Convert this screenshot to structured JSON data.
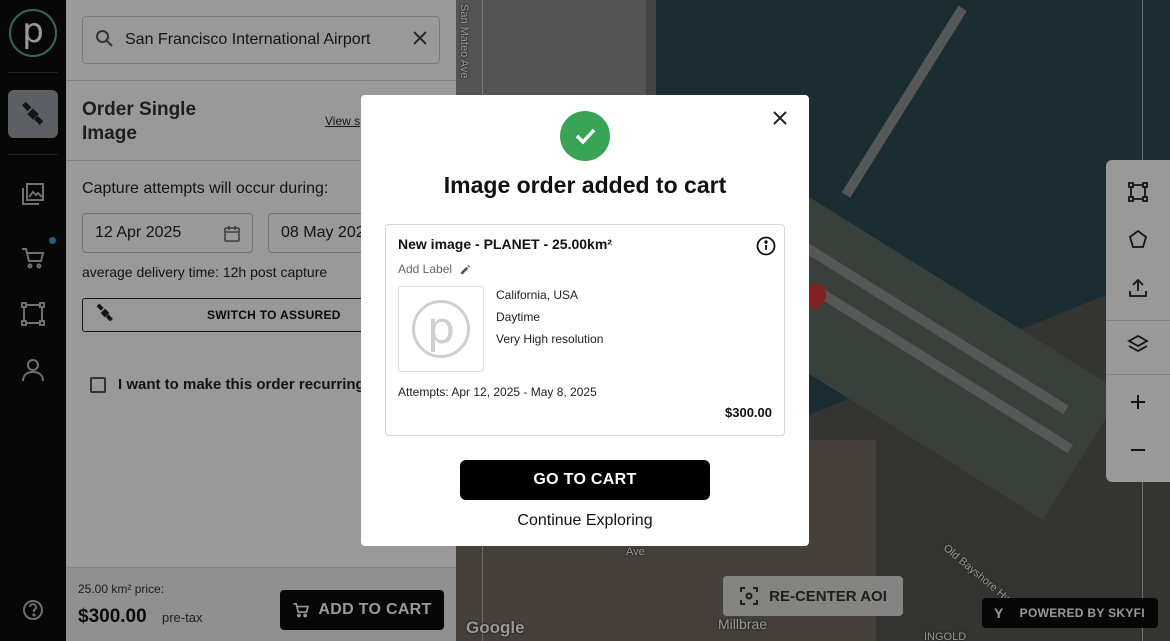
{
  "search": {
    "value": "San Francisco International Airport"
  },
  "panel": {
    "title": "Order Single Image",
    "view_link": "View s",
    "capture_label": "Capture attempts will occur during:",
    "start_date": "12 Apr 2025",
    "end_date": "08 May 202",
    "avg_delivery": "average delivery time: 12h post capture",
    "switch_label": "SWITCH TO ASSURED",
    "recurring_label": "I want to make this order recurring"
  },
  "footer": {
    "price_label": "25.00 km² price:",
    "price": "$300.00",
    "pretax": "pre-tax",
    "cart_button": "ADD TO CART"
  },
  "map": {
    "street_1": "San Mateo Ave",
    "street_2": "Old Bayshore Hwy",
    "street_3": "Ave",
    "place": "Millbrae",
    "place_2": "INGOLD",
    "attribution": "Google",
    "recenter": "RE-CENTER AOI",
    "powered": "POWERED BY SKYFI"
  },
  "modal": {
    "heading": "Image order added to cart",
    "card": {
      "title": "New image - PLANET - 25.00km²",
      "add_label": "Add Label",
      "location": "California, USA",
      "time": "Daytime",
      "resolution": "Very High resolution",
      "attempts": "Attempts: Apr 12, 2025 - May 8, 2025",
      "price": "$300.00"
    },
    "go_to_cart": "GO TO CART",
    "continue": "Continue Exploring"
  },
  "colors": {
    "accent_green": "#38a456",
    "brand_teal": "#5aa7a3",
    "notification": "#3aa0d8"
  }
}
